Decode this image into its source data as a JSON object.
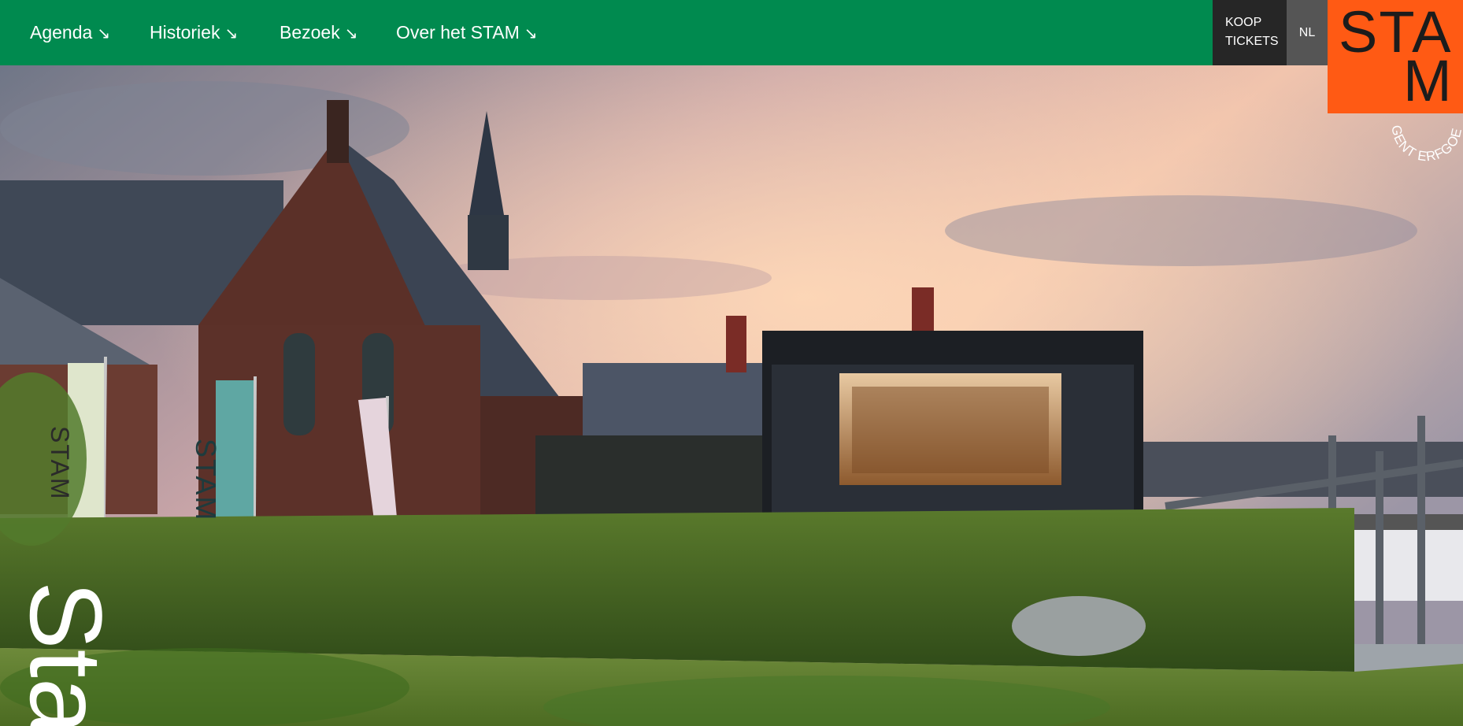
{
  "nav": {
    "items": [
      {
        "label": "Agenda",
        "arrow": "↘"
      },
      {
        "label": "Historiek",
        "arrow": "↘"
      },
      {
        "label": "Bezoek",
        "arrow": "↘"
      },
      {
        "label": "Over het STAM",
        "arrow": "↘"
      }
    ],
    "tickets_line1": "KOOP",
    "tickets_line2": "TICKETS",
    "language": "NL"
  },
  "logo": {
    "line1": "STA",
    "line2": "M",
    "ring_text": "GENT ERFGOEDCE"
  },
  "hero": {
    "flag_text": "STAM",
    "corner_text": "Sta"
  },
  "colors": {
    "nav_green": "#008a4f",
    "logo_orange": "#ff5a14",
    "tickets_bg": "#262626",
    "lang_bg": "#555555"
  }
}
